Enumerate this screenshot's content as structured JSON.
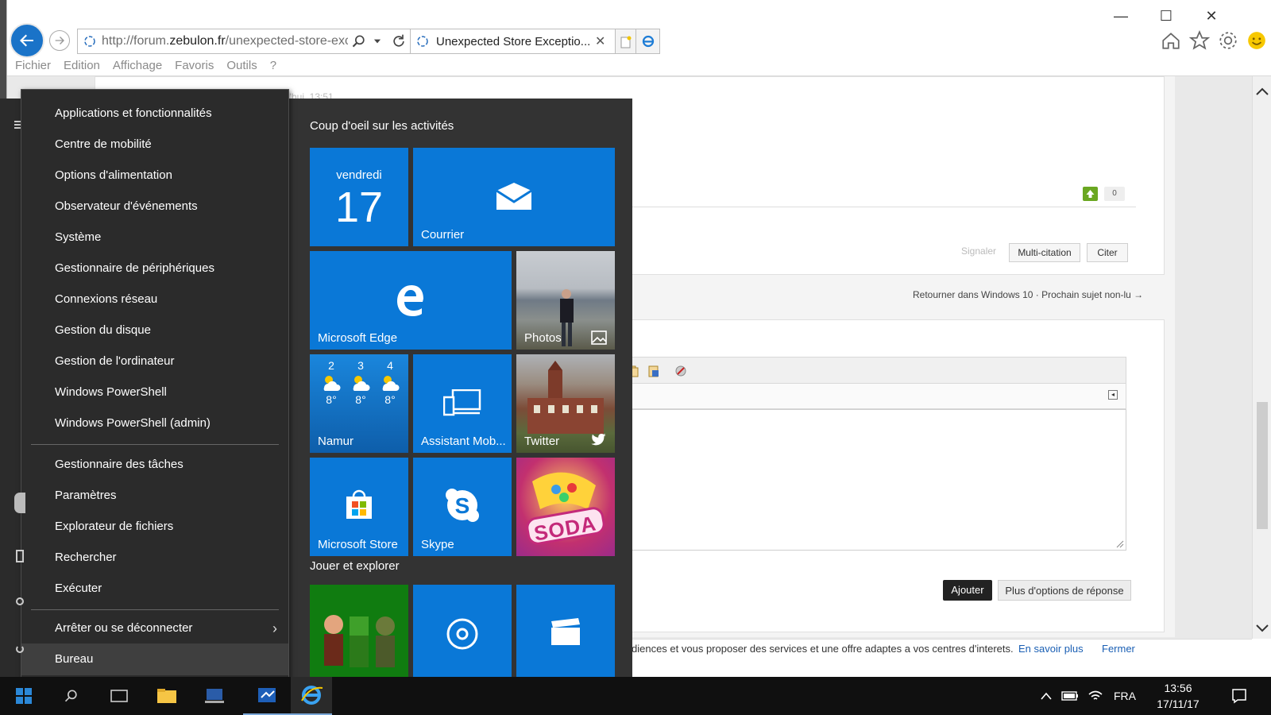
{
  "browser": {
    "url_prefix": "http://forum.",
    "url_domain": "zebulon.fr",
    "url_rest": "/unexpected-store-exc",
    "tab_title": "Unexpected Store Exceptio...",
    "menu": [
      "Fichier",
      "Edition",
      "Affichage",
      "Favoris",
      "Outils",
      "?"
    ],
    "accent": "#1a73c8"
  },
  "forum": {
    "post_time": "d'hui, 13:51",
    "vote_count": "0",
    "signaler": "Signaler",
    "multi_citation": "Multi-citation",
    "citer": "Citer",
    "nav_back": "Retourner dans Windows 10",
    "nav_sep": "·",
    "nav_next": "Prochain sujet non-lu →",
    "ajouter": "Ajouter",
    "plus_options": "Plus d'options de réponse",
    "cookie_text": "diences et vous proposer des services et une offre adaptes a vos centres d'interets.",
    "cookie_more": "En savoir plus",
    "cookie_close": "Fermer"
  },
  "context_menu": {
    "group1": [
      "Applications et fonctionnalités",
      "Centre de mobilité",
      "Options d'alimentation",
      "Observateur d'événements",
      "Système",
      "Gestionnaire de périphériques",
      "Connexions réseau",
      "Gestion du disque",
      "Gestion de l'ordinateur",
      "Windows PowerShell",
      "Windows PowerShell (admin)"
    ],
    "group2": [
      "Gestionnaire des tâches",
      "Paramètres",
      "Explorateur de fichiers",
      "Rechercher",
      "Exécuter"
    ],
    "group3": [
      "Arrêter ou se déconnecter",
      "Bureau"
    ]
  },
  "start": {
    "section1": "Coup d'oeil sur les activités",
    "section2": "Jouer et explorer",
    "calendar_day": "vendredi",
    "calendar_num": "17",
    "mail": "Courrier",
    "edge": "Microsoft Edge",
    "photos": "Photos",
    "weather": {
      "city": "Namur",
      "days": [
        {
          "d": "2",
          "t": "8°"
        },
        {
          "d": "3",
          "t": "8°"
        },
        {
          "d": "4",
          "t": "8°"
        }
      ]
    },
    "assistant": "Assistant Mob...",
    "twitter": "Twitter",
    "store": "Microsoft Store",
    "skype": "Skype",
    "tile_color": "#0a78d7"
  },
  "taskbar": {
    "lang": "FRA",
    "time": "13:56",
    "date": "17/11/17"
  }
}
